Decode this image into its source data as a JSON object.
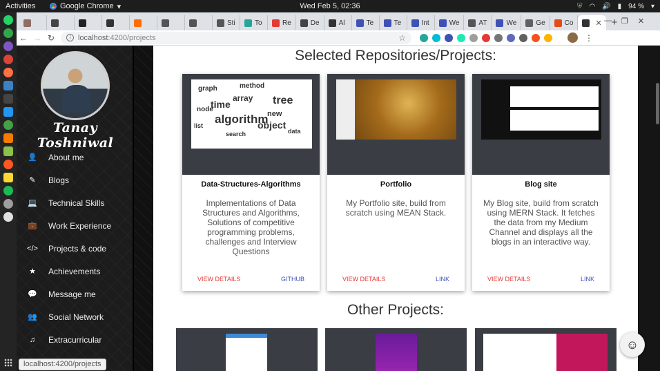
{
  "system": {
    "activities": "Activities",
    "app_name": "Google Chrome",
    "clock": "Wed Feb  5, 02:36",
    "battery": "94 %"
  },
  "browser": {
    "tabs": [
      {
        "label": "",
        "color": "#8d6e63"
      },
      {
        "label": "",
        "color": "#444444"
      },
      {
        "label": "",
        "color": "#222222"
      },
      {
        "label": "",
        "color": "#333333"
      },
      {
        "label": "",
        "color": "#ff6d00"
      },
      {
        "label": "",
        "color": "#555555"
      },
      {
        "label": "",
        "color": "#555555"
      },
      {
        "label": "Sti",
        "color": "#555555"
      },
      {
        "label": "To",
        "color": "#26a69a"
      },
      {
        "label": "Re",
        "color": "#e53935"
      },
      {
        "label": "De",
        "color": "#444444"
      },
      {
        "label": "Al",
        "color": "#333333"
      },
      {
        "label": "Te",
        "color": "#3f51b5"
      },
      {
        "label": "Te",
        "color": "#3f51b5"
      },
      {
        "label": "Int",
        "color": "#3f51b5"
      },
      {
        "label": "We",
        "color": "#3f51b5"
      },
      {
        "label": "AT",
        "color": "#555555"
      },
      {
        "label": "We",
        "color": "#3f51b5"
      },
      {
        "label": "Ge",
        "color": "#616161"
      },
      {
        "label": "Co",
        "color": "#e64a19"
      }
    ],
    "active_tab": {
      "label": "",
      "color": "#333333"
    },
    "url_host": "localhost",
    "url_path": ":4200/projects",
    "status_url": "localhost:4200/projects"
  },
  "sidebar": {
    "name": "Tanay Toshniwal",
    "items": [
      {
        "label": "About me",
        "icon": "user-icon",
        "glyph": "👤"
      },
      {
        "label": "Blogs",
        "icon": "pencil-icon",
        "glyph": "✎"
      },
      {
        "label": "Technical Skills",
        "icon": "laptop-icon",
        "glyph": "💻"
      },
      {
        "label": "Work Experience",
        "icon": "briefcase-icon",
        "glyph": "💼"
      },
      {
        "label": "Projects & code",
        "icon": "code-icon",
        "glyph": "</>"
      },
      {
        "label": "Achievements",
        "icon": "star-icon",
        "glyph": "★"
      },
      {
        "label": "Message me",
        "icon": "chat-icon",
        "glyph": "💬"
      },
      {
        "label": "Social Network",
        "icon": "users-icon",
        "glyph": "👥"
      },
      {
        "label": "Extracurricular",
        "icon": "music-icon",
        "glyph": "♫"
      }
    ]
  },
  "main": {
    "selected_title": "Selected Repositories/Projects:",
    "other_title": "Other Projects:",
    "cards": [
      {
        "title": "Data-Structures-Algorithms",
        "description": "Implementations of Data Structures and Algorithms, Solutions of competitive programming problems, challenges and Interview Questions",
        "action1": "VIEW DETAILS",
        "action2": "GITHUB"
      },
      {
        "title": "Portfolio",
        "description": "My Portfolio site, build from scratch using MEAN Stack.",
        "action1": "VIEW DETAILS",
        "action2": "LINK"
      },
      {
        "title": "Blog site",
        "description": "My Blog site, build from scratch using MERN Stack. It fetches the data from my Medium Channel and displays all the blogs in an interactive way.",
        "action1": "VIEW DETAILS",
        "action2": "LINK"
      }
    ],
    "wordcloud_words": [
      "algorithm",
      "time",
      "tree",
      "array",
      "object",
      "node",
      "new",
      "search",
      "method",
      "list",
      "data",
      "graph"
    ]
  },
  "colors": {
    "details_action": "#e53935",
    "link_action": "#3f51b5",
    "card_thumb_bg": "#3a3d44"
  }
}
